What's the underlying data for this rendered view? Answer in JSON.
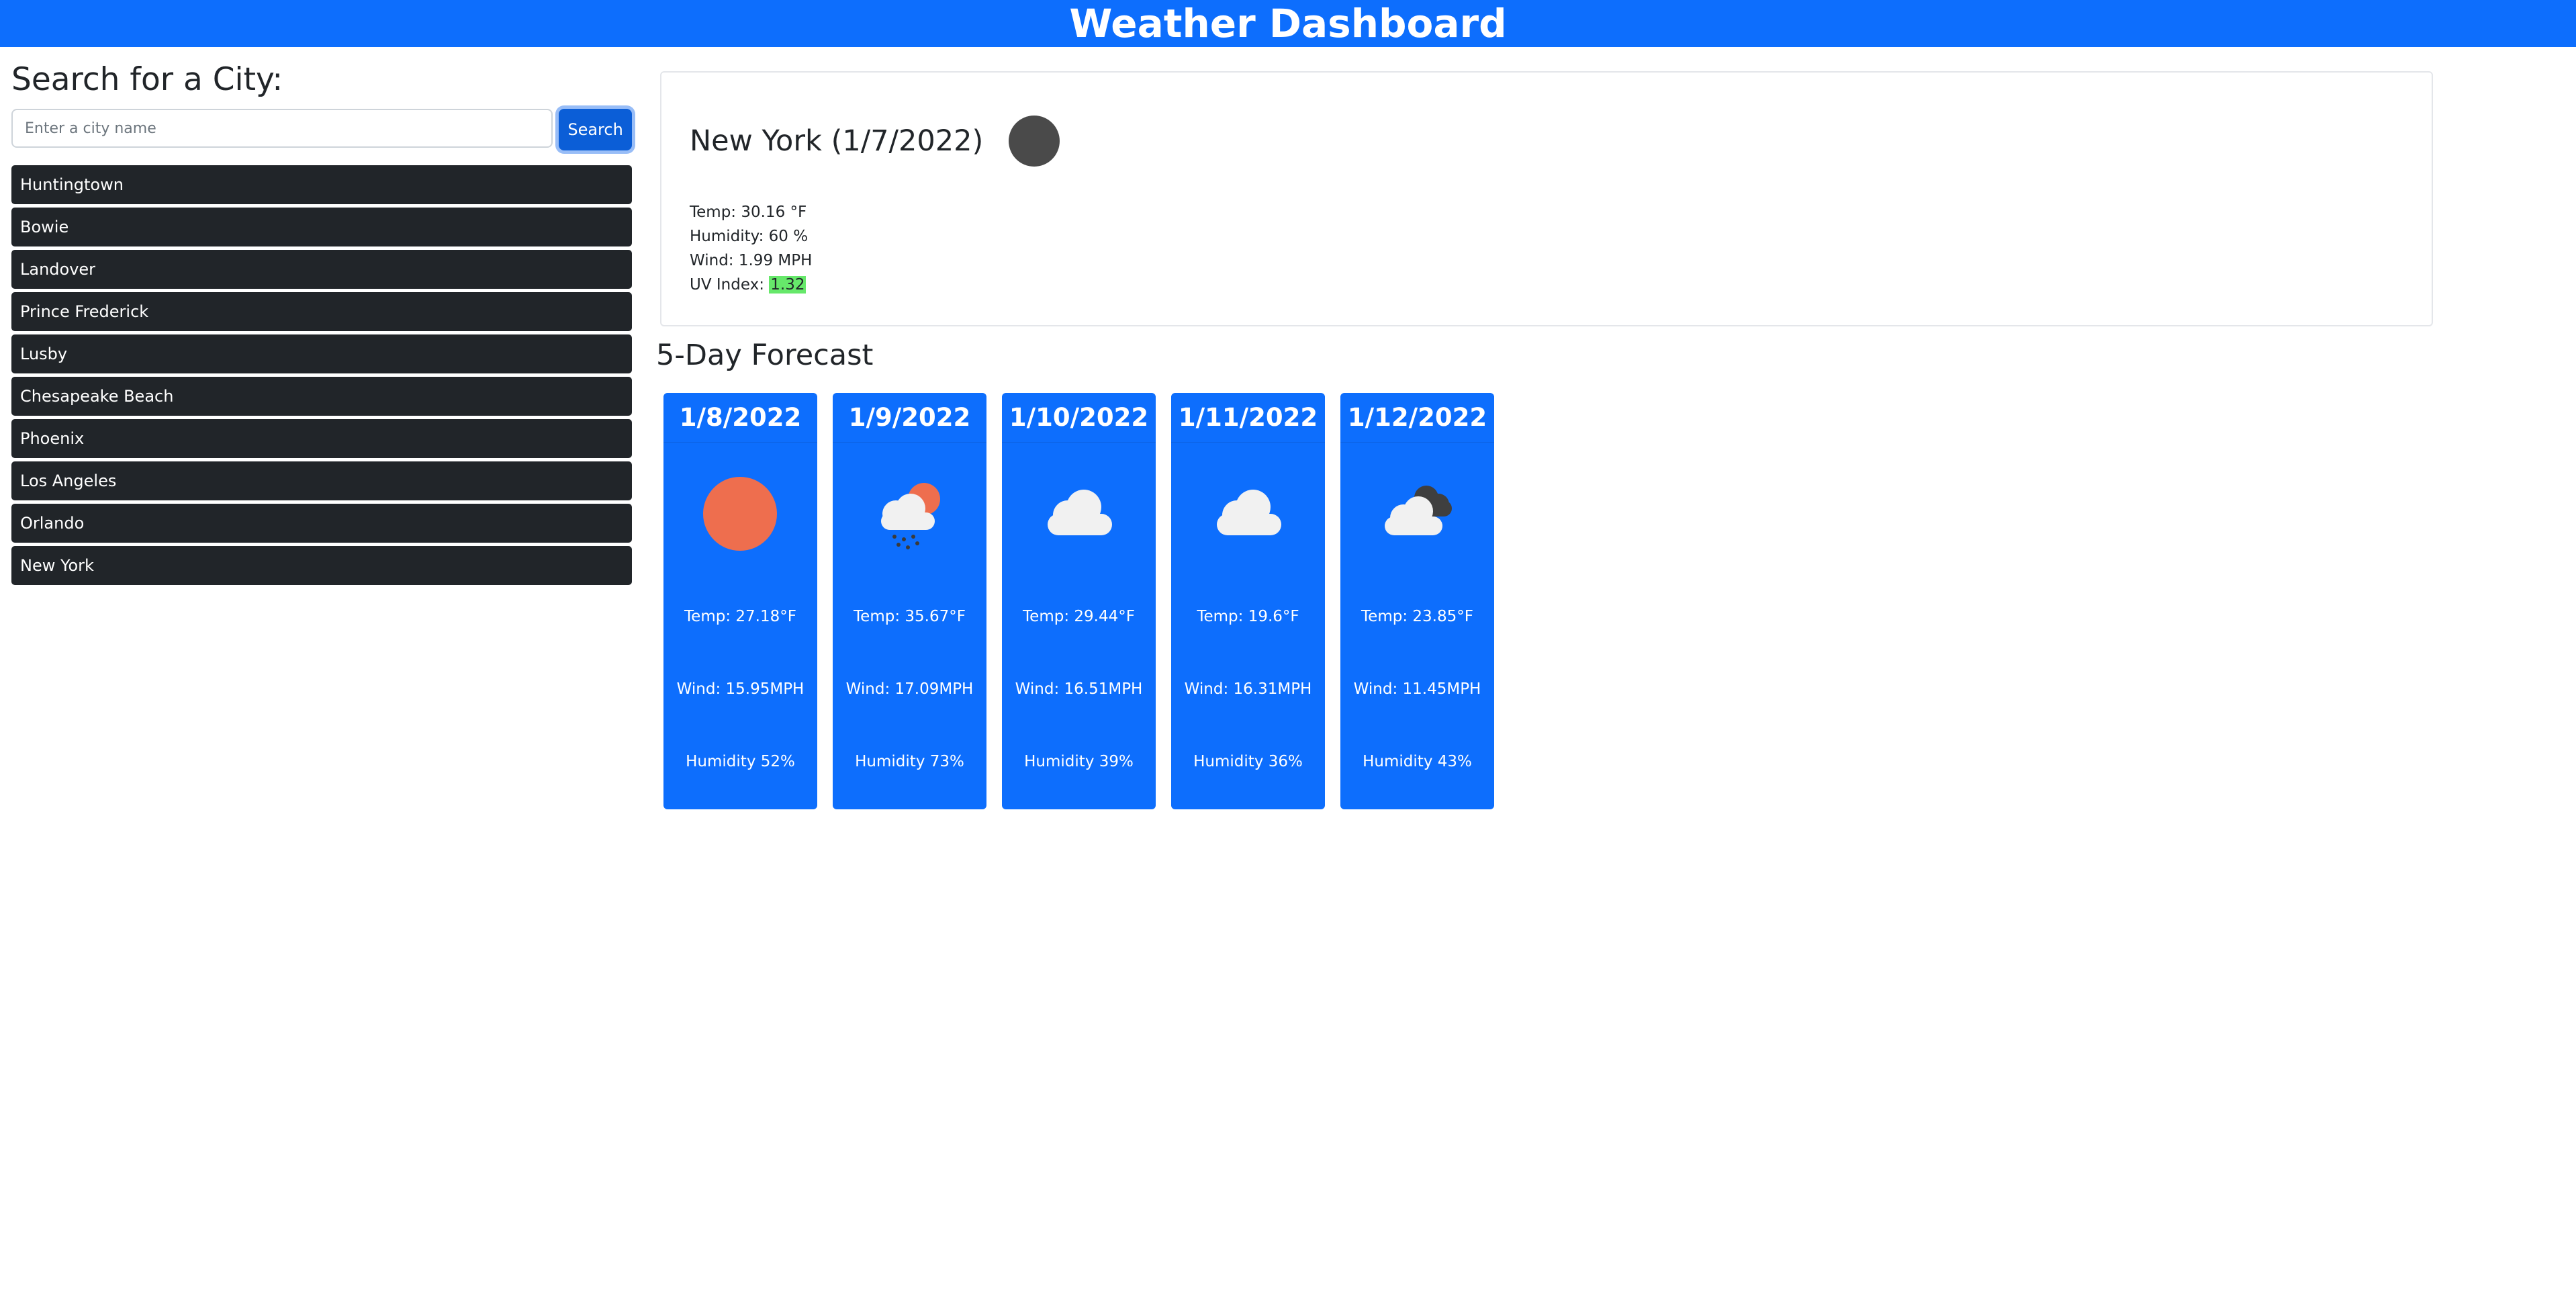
{
  "header": {
    "title": "Weather Dashboard"
  },
  "search": {
    "heading": "Search for a City:",
    "placeholder": "Enter a city name",
    "button_label": "Search"
  },
  "history": [
    "Huntingtown",
    "Bowie",
    "Landover",
    "Prince Frederick",
    "Lusby",
    "Chesapeake Beach",
    "Phoenix",
    "Los Angeles",
    "Orlando",
    "New York"
  ],
  "current": {
    "title": "New York (1/7/2022)",
    "icon": "dark-circle-icon",
    "temp_label": "Temp: 30.16 °F",
    "humidity_label": "Humidity: 60 %",
    "wind_label": "Wind: 1.99 MPH",
    "uv_prefix": "UV Index: ",
    "uv_value": "1.32"
  },
  "forecast": {
    "heading": "5-Day Forecast",
    "days": [
      {
        "date": "1/8/2022",
        "icon": "sun-icon",
        "temp": "Temp: 27.18°F",
        "wind": "Wind: 15.95MPH",
        "humidity": "Humidity 52%"
      },
      {
        "date": "1/9/2022",
        "icon": "rain-sun-cloud-icon",
        "temp": "Temp: 35.67°F",
        "wind": "Wind: 17.09MPH",
        "humidity": "Humidity 73%"
      },
      {
        "date": "1/10/2022",
        "icon": "cloud-icon",
        "temp": "Temp: 29.44°F",
        "wind": "Wind: 16.51MPH",
        "humidity": "Humidity 39%"
      },
      {
        "date": "1/11/2022",
        "icon": "cloud-icon",
        "temp": "Temp: 19.6°F",
        "wind": "Wind: 16.31MPH",
        "humidity": "Humidity 36%"
      },
      {
        "date": "1/12/2022",
        "icon": "broken-clouds-icon",
        "temp": "Temp: 23.85°F",
        "wind": "Wind: 11.45MPH",
        "humidity": "Humidity 43%"
      }
    ]
  },
  "colors": {
    "primary": "#0d6efd",
    "dark_button": "#212529",
    "uv_good": "#66e86a",
    "sun": "#ee6e4e"
  }
}
